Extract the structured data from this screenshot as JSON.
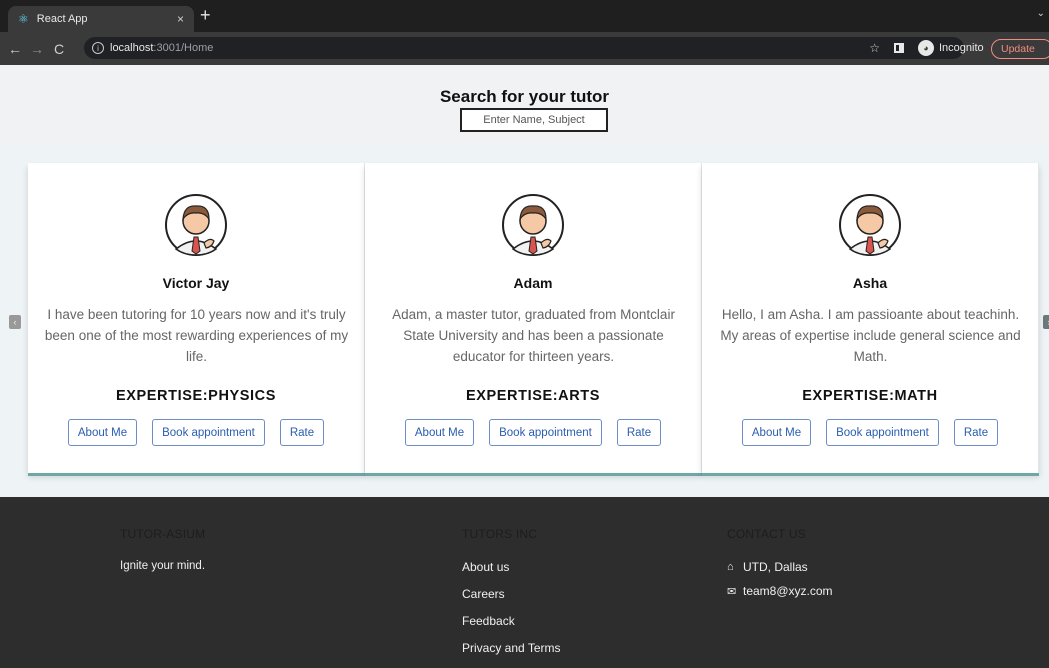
{
  "browser": {
    "tab_title": "React App",
    "tab_close": "×",
    "new_tab": "+",
    "url_host": "localhost",
    "url_path": ":3001/Home",
    "incognito_label": "Incognito",
    "update_label": "Update"
  },
  "search": {
    "title": "Search for your tutor",
    "placeholder": "Enter Name, Subject"
  },
  "tutors": [
    {
      "name": "Victor Jay",
      "bio": "I have been tutoring for 10 years now and it's truly been one of the most rewarding experiences of my life.",
      "expertise": "EXPERTISE:PHYSICS"
    },
    {
      "name": "Adam",
      "bio": "Adam, a master tutor, graduated from Montclair State University and has been a passionate educator for thirteen years.",
      "expertise": "EXPERTISE:ARTS"
    },
    {
      "name": "Asha",
      "bio": "Hello, I am Asha. I am passioante about teachinh. My areas of expertise include general science and Math.",
      "expertise": "EXPERTISE:MATH"
    }
  ],
  "card_buttons": {
    "about": "About Me",
    "book": "Book appointment",
    "rate": "Rate"
  },
  "footer": {
    "brand_title": "TUTOR-ASIUM",
    "tagline": "Ignite your mind.",
    "links_title": "TUTORS INC",
    "links": [
      "About us",
      "Careers",
      "Feedback",
      "Privacy and Terms"
    ],
    "contact_title": "CONTACT US",
    "address": "UTD, Dallas",
    "email": "team8@xyz.com"
  },
  "colors": {
    "accent": "#2a5db0",
    "card_shadow": "#6fa6a6",
    "footer_bg": "#2d2d2d"
  }
}
